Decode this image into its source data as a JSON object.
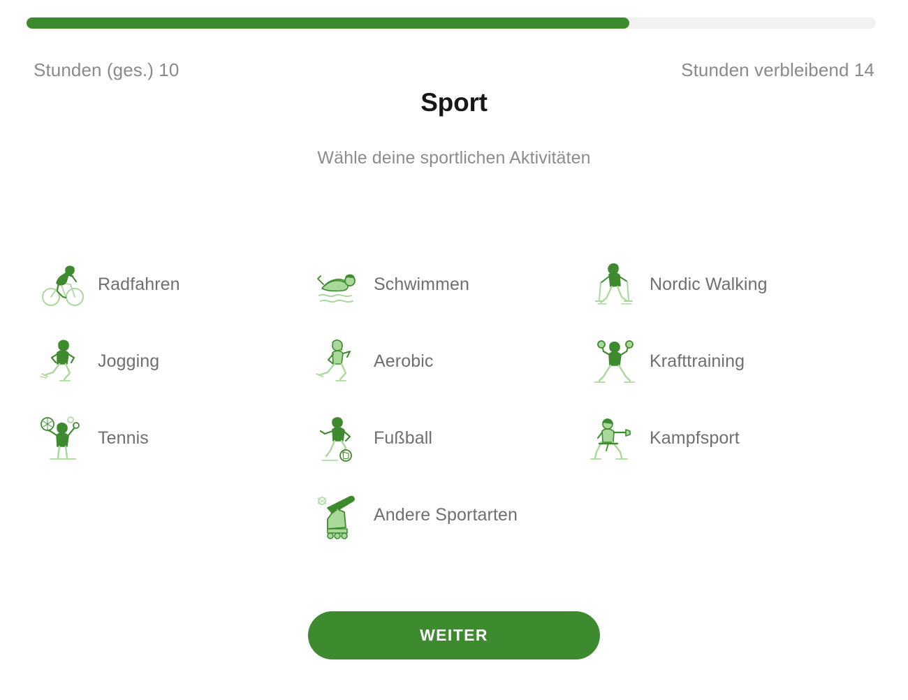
{
  "theme": {
    "brand_green": "#3d8b2e",
    "icon_dark_green": "#3d8b2e",
    "icon_light_green": "#a9d99a",
    "track_grey": "#f1f1f1",
    "label_grey": "#8a8a8a",
    "title_black": "#171717"
  },
  "progress": {
    "percent": 71,
    "name": "onboarding-progress"
  },
  "header": {
    "hours_total_label": "Stunden (ges.) 10",
    "hours_remaining_label": "Stunden verbleibend 14"
  },
  "page": {
    "title": "Sport",
    "subtitle": "Wähle deine sportlichen Aktivitäten"
  },
  "activities": [
    {
      "id": "radfahren",
      "label": "Radfahren",
      "icon": "cyclist-icon"
    },
    {
      "id": "schwimmen",
      "label": "Schwimmen",
      "icon": "swimmer-icon"
    },
    {
      "id": "nordic-walking",
      "label": "Nordic Walking",
      "icon": "nordic-walker-icon"
    },
    {
      "id": "jogging",
      "label": "Jogging",
      "icon": "jogger-icon"
    },
    {
      "id": "aerobic",
      "label": "Aerobic",
      "icon": "aerobic-icon"
    },
    {
      "id": "krafttraining",
      "label": "Krafttraining",
      "icon": "weightlifter-icon"
    },
    {
      "id": "tennis",
      "label": "Tennis",
      "icon": "tennis-player-icon"
    },
    {
      "id": "fussball",
      "label": "Fußball",
      "icon": "footballer-icon"
    },
    {
      "id": "kampfsport",
      "label": "Kampfsport",
      "icon": "martial-artist-icon"
    },
    {
      "id": "andere-sportarten",
      "label": "Andere Sportarten",
      "icon": "rollerskate-bat-icon"
    }
  ],
  "footer": {
    "continue_label": "WEITER"
  }
}
